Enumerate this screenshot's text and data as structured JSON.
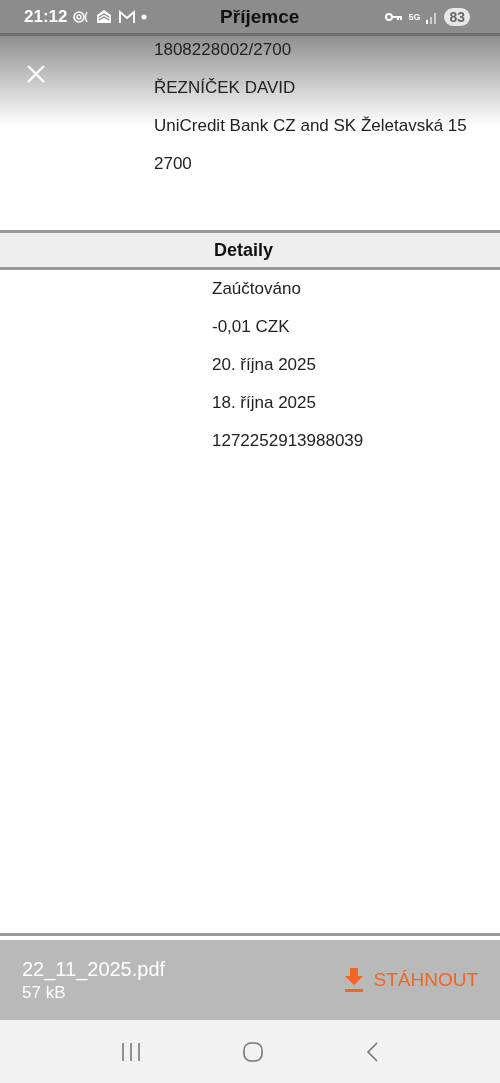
{
  "status_bar": {
    "time": "21:12",
    "network": "5G",
    "battery": "83"
  },
  "recipient": {
    "title": "Příjemce",
    "lines": [
      "1808228002/2700",
      "ŘEZNÍČEK DAVID",
      "UniCredit Bank CZ and SK Želetavská 15",
      "2700"
    ]
  },
  "details": {
    "title": "Detaily",
    "lines": [
      "Zaúčtováno",
      "-0,01 CZK",
      "20. října 2025",
      "18. října 2025",
      "1272252913988039"
    ]
  },
  "attachment": {
    "file_name": "22_11_2025.pdf",
    "size": "57 kB",
    "download_label": "STÁHNOUT"
  }
}
